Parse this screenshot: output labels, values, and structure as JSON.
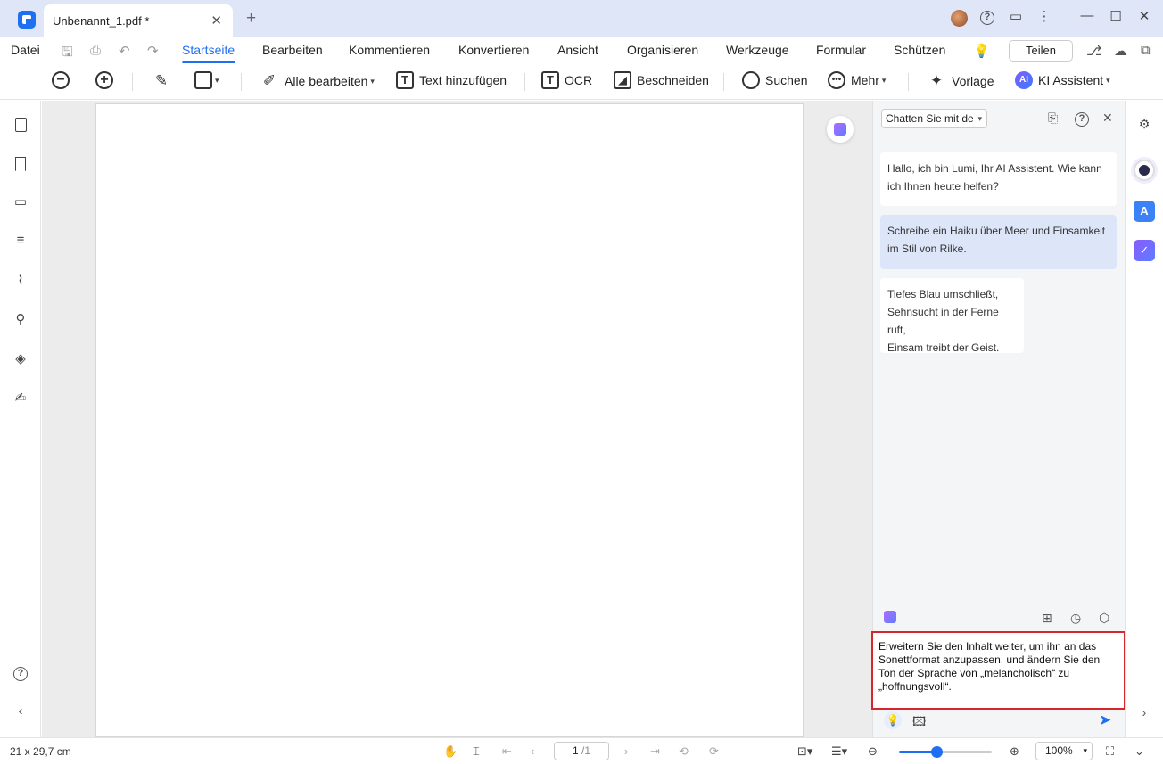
{
  "titlebar": {
    "tab_title": "Unbenannt_1.pdf *",
    "close_tab": "✕",
    "new_tab": "+"
  },
  "menubar": {
    "file": "Datei",
    "items": [
      "Startseite",
      "Bearbeiten",
      "Kommentieren",
      "Konvertieren",
      "Ansicht",
      "Organisieren",
      "Werkzeuge",
      "Formular",
      "Schützen"
    ],
    "share_label": "Teilen"
  },
  "toolbar": {
    "edit_all": "Alle bearbeiten",
    "add_text": "Text hinzufügen",
    "ocr": "OCR",
    "crop": "Beschneiden",
    "search": "Suchen",
    "more": "Mehr",
    "template": "Vorlage",
    "ai_assistant": "KI Assistent",
    "ai_badge": "AI"
  },
  "chat": {
    "mode_select": "Chatten Sie mit de",
    "messages": [
      {
        "role": "assistant",
        "text": "Hallo, ich bin Lumi, Ihr AI Assistent. Wie kann ich Ihnen heute helfen?"
      },
      {
        "role": "user",
        "text": "Schreibe ein Haiku über Meer und Einsamkeit im Stil von Rilke."
      },
      {
        "role": "assistant",
        "text": "Tiefes Blau umschließt,\nSehnsucht in der Ferne ruft,\nEinsam treibt der Geist."
      }
    ],
    "input_value": "Erweitern Sie den Inhalt weiter, um ihn an das Sonettformat anzupassen, und ändern Sie den Ton der Sprache von „melancholisch“ zu „hoffnungsvoll“."
  },
  "statusbar": {
    "page_size": "21 x 29,7 cm",
    "page_indicator": "1",
    "page_total": "/1",
    "zoom": "100%",
    "zoom_level": 0.4
  },
  "colors": {
    "accent": "#1f6ff2",
    "highlight_border": "#d6262b",
    "titlebar_bg": "#dfe6f7",
    "user_bubble": "#dde6f8"
  }
}
